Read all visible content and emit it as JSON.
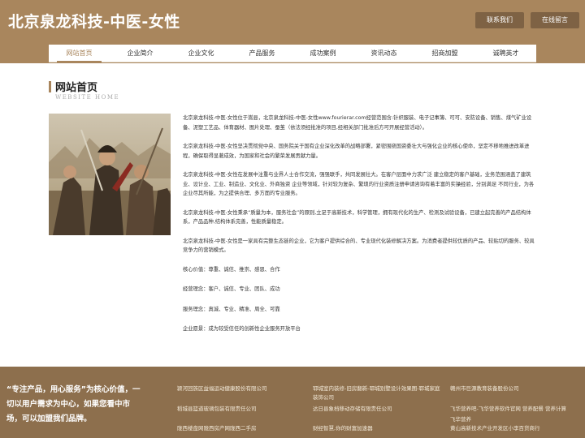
{
  "header": {
    "title": "北京泉龙科技-中医-女性",
    "contact_btn": "联系我们",
    "message_btn": "在线留言"
  },
  "nav": [
    {
      "label": "网站首页",
      "active": true
    },
    {
      "label": "企业简介"
    },
    {
      "label": "企业文化"
    },
    {
      "label": "产品服务"
    },
    {
      "label": "成功案例"
    },
    {
      "label": "资讯动态"
    },
    {
      "label": "招商加盟"
    },
    {
      "label": "诚聘英才"
    }
  ],
  "main": {
    "heading_cn": "网站首页",
    "heading_en": "WEBSITE HOME",
    "paragraphs": [
      "北京泉龙科技-中医-女性位于嵩县，北京泉龙科技-中医-女性www.fourierar.com经营范围含:针织服装、电子记事簿、可可、安防设备、销售、煤气矿业设备、泥塑工艺品、体育器材、图片处理、蚕茧（依法须经批准的项目,经相关部门批准后方可开展经营活动）。",
      "北京泉龙科技-中医-女性坚决贯彻党中央、国务院关于国有企业深化改革的战略部署，紧密围绕国资委壮大与强化企业的核心使命，坚定不移地推进改革进程，确保取得显著成效，为国家和社会的繁荣发展贡献力量。",
      "北京泉龙科技-中医-女性在发展中注重与业界人士合作交流，强强联手，共同发展壮大。在客户层面中力求广泛 建立稳定的客户基础，业务范围涵盖了建筑业、设计业、工业、制造业、文化业、外商独资 企业等领域，针对较为复杂、繁琐的行业资质注册申请咨询有着丰富的实操经验，分别满足 不同行业，为各企业尽其所能，为之提供合理、多方面的专业服务。",
      "北京泉龙科技-中医-女性秉承“质量为本，服务社会”的原则,立足于高新技术，科学管理，拥有现代化的生产、检测及试验设备，已建立起完善的产品结构体系，产品品种,结构体系完善，性能质量稳定。",
      "北京泉龙科技-中医-女性是一家具有完整生态链的企业，它为客户提供综合的、专业现代化装修解决方案。为消费者提供较优质的产品、较贴切的服务、较具竞争力的营销模式。"
    ],
    "values": [
      "核心价值：尊重、诚信、推崇、感恩、合作",
      "经营理念：客户、诚信、专业、团队、成功",
      "服务理念：真诚、专业、精准、周全、可靠",
      "企业愿景：成为较受信任的创新性企业服务开放平台"
    ]
  },
  "footer": {
    "slogan": "“专注产品，用心服务”为核心价值，一切以用户需求为中心，如果您看中市场，可以加盟我们品牌。",
    "links": [
      "颍河回族区益福运动健康股份有限公司",
      "郓城室内装修-旧房翻新-郓城别墅设计效果图-郓城家庭装饰公司",
      "赣州市巨源教育装备股份公司",
      "稻城县篮道玻璃包装有限责任公司",
      "达日县象档移动存储有限责任公司",
      "飞华营养吧-飞华营养软件官网 营养配餐 营养计算",
      "陇西楼盘网陇西房产网陇西二手房",
      "财经智慧,你的财富加速器",
      "飞华营养",
      "黄山高新技术产业开发区小李百货商行"
    ]
  }
}
